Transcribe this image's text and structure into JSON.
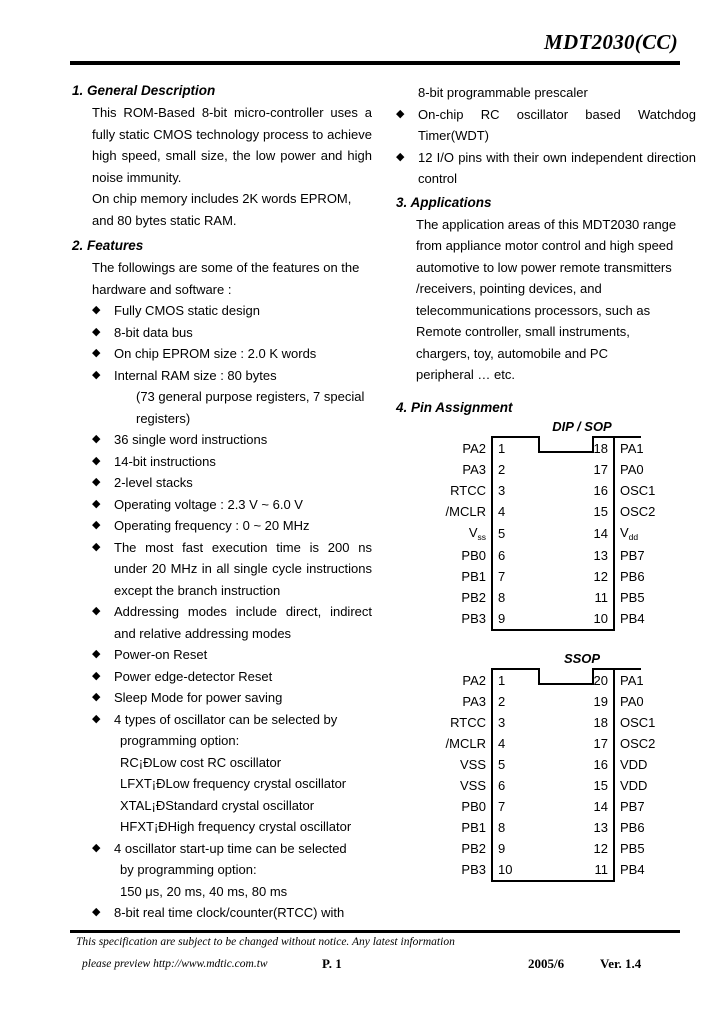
{
  "header": {
    "doc_title": "MDT2030(CC)"
  },
  "sections": {
    "general_description": {
      "heading": "1. General Description",
      "paragraphs": [
        "This ROM-Based 8-bit micro-controller uses a fully static CMOS technology process to achieve high speed, small size, the low power and high noise immunity.",
        "On chip memory includes 2K words EPROM, and 80 bytes static RAM."
      ]
    },
    "features": {
      "heading": "2. Features",
      "intro": "The followings are some of the features on the hardware and software :",
      "items": [
        {
          "text": "Fully CMOS static design"
        },
        {
          "text": "8-bit data bus"
        },
        {
          "text": "On chip EPROM size : 2.0 K words"
        },
        {
          "text": "Internal RAM size : 80 bytes",
          "sub": "(73 general purpose registers, 7 special",
          "sub_cont": "registers)"
        },
        {
          "text": "36 single word instructions"
        },
        {
          "text": "14-bit instructions"
        },
        {
          "text": "2-level stacks"
        },
        {
          "text": "Operating voltage : 2.3 V ~ 6.0 V"
        },
        {
          "text": "Operating frequency : 0 ~ 20 MHz"
        },
        {
          "text": "The most fast execution time is 200 ns under 20 MHz in all single cycle instructions except the branch instruction",
          "justify": true
        },
        {
          "text": "Addressing modes include direct, indirect and relative addressing modes",
          "justify": true
        },
        {
          "text": "Power-on Reset"
        },
        {
          "text": "Power edge-detector Reset"
        },
        {
          "text": "Sleep Mode for power saving"
        },
        {
          "text": "4 types of oscillator can be selected by",
          "justify": true,
          "lines": [
            "programming option:",
            "RC¡ÐLow cost RC oscillator",
            "LFXT¡ÐLow frequency crystal oscillator",
            "XTAL¡ÐStandard crystal oscillator",
            "HFXT¡ÐHigh frequency crystal oscillator"
          ]
        },
        {
          "text": "4 oscillator start-up time can be selected",
          "lines": [
            "by programming option:",
            "150 μs, 20 ms, 40 ms, 80 ms"
          ]
        },
        {
          "text": "8-bit real time clock/counter(RTCC) with"
        }
      ],
      "continued_right": [
        {
          "text": "8-bit programmable prescaler",
          "no_bullet": true
        },
        {
          "text": "On-chip RC oscillator based Watchdog Timer(WDT)",
          "justify": true
        },
        {
          "text": "12 I/O pins with their own independent direction control",
          "justify": true
        }
      ]
    },
    "applications": {
      "heading": "3. Applications",
      "lines": [
        "The application areas of this MDT2030 range",
        "from appliance motor control and high speed",
        "automotive to low power remote transmitters",
        "/receivers, pointing devices, and",
        "telecommunications processors, such as",
        "Remote controller, small instruments,",
        "chargers, toy, automobile and PC",
        "peripheral … etc."
      ]
    },
    "pin_assignment": {
      "heading": "4. Pin Assignment",
      "packages": [
        {
          "title": "DIP / SOP",
          "rows": [
            {
              "left_label": "PA2",
              "left_pin": "1",
              "right_pin": "18",
              "right_label": "PA1"
            },
            {
              "left_label": "PA3",
              "left_pin": "2",
              "right_pin": "17",
              "right_label": "PA0"
            },
            {
              "left_label": "RTCC",
              "left_pin": "3",
              "right_pin": "16",
              "right_label": "OSC1"
            },
            {
              "left_label": "/MCLR",
              "left_pin": "4",
              "right_pin": "15",
              "right_label": "OSC2"
            },
            {
              "left_label": "Vss",
              "left_label_base": "V",
              "left_label_sub": "ss",
              "left_pin": "5",
              "right_pin": "14",
              "right_label": "Vdd",
              "right_label_base": "V",
              "right_label_sub": "dd"
            },
            {
              "left_label": "PB0",
              "left_pin": "6",
              "right_pin": "13",
              "right_label": "PB7"
            },
            {
              "left_label": "PB1",
              "left_pin": "7",
              "right_pin": "12",
              "right_label": "PB6"
            },
            {
              "left_label": "PB2",
              "left_pin": "8",
              "right_pin": "11",
              "right_label": "PB5"
            },
            {
              "left_label": "PB3",
              "left_pin": "9",
              "right_pin": "10",
              "right_label": "PB4"
            }
          ]
        },
        {
          "title": "SSOP",
          "rows": [
            {
              "left_label": "PA2",
              "left_pin": "1",
              "right_pin": "20",
              "right_label": "PA1"
            },
            {
              "left_label": "PA3",
              "left_pin": "2",
              "right_pin": "19",
              "right_label": "PA0"
            },
            {
              "left_label": "RTCC",
              "left_pin": "3",
              "right_pin": "18",
              "right_label": "OSC1"
            },
            {
              "left_label": "/MCLR",
              "left_pin": "4",
              "right_pin": "17",
              "right_label": "OSC2"
            },
            {
              "left_label": "VSS",
              "left_pin": "5",
              "right_pin": "16",
              "right_label": "VDD"
            },
            {
              "left_label": "VSS",
              "left_pin": "6",
              "right_pin": "15",
              "right_label": "VDD"
            },
            {
              "left_label": "PB0",
              "left_pin": "7",
              "right_pin": "14",
              "right_label": "PB7"
            },
            {
              "left_label": "PB1",
              "left_pin": "8",
              "right_pin": "13",
              "right_label": "PB6"
            },
            {
              "left_label": "PB2",
              "left_pin": "9",
              "right_pin": "12",
              "right_label": "PB5"
            },
            {
              "left_label": "PB3",
              "left_pin": "10",
              "right_pin": "11",
              "right_label": "PB4"
            }
          ]
        }
      ]
    }
  },
  "footer": {
    "disclaimer_line1": "This specification are subject to be changed without notice. Any latest information",
    "disclaimer_line2": "please preview http://www.mdtic.com.tw",
    "page": "P. 1",
    "date": "2005/6",
    "version": "Ver. 1.4"
  },
  "icons": {
    "bullet": "◆"
  }
}
